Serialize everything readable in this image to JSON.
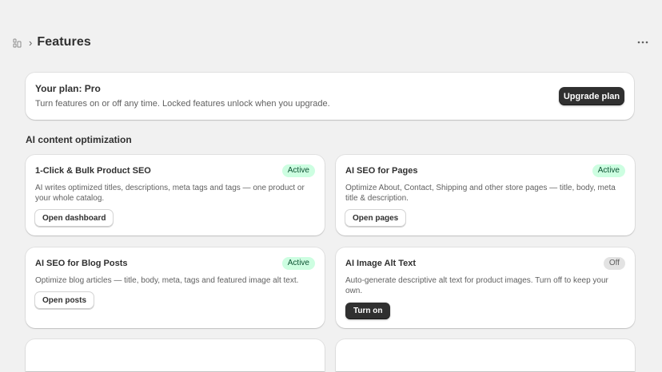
{
  "header": {
    "app_icon": "app-grid-icon",
    "breadcrumb_separator": "›",
    "title": "Features",
    "more_icon": "ellipsis-icon"
  },
  "plan": {
    "title": "Your plan: Pro",
    "description": "Turn features on or off any time. Locked features unlock when you upgrade.",
    "upgrade_label": "Upgrade plan"
  },
  "section": {
    "title": "AI content optimization"
  },
  "features": [
    {
      "title": "1-Click & Bulk Product SEO",
      "status": "Active",
      "description": "AI writes optimized titles, descriptions, meta tags and tags — one product or your whole catalog.",
      "action": "Open dashboard"
    },
    {
      "title": "AI SEO for Pages",
      "status": "Active",
      "description": "Optimize About, Contact, Shipping and other store pages — title, body, meta title & description.",
      "action": "Open pages"
    },
    {
      "title": "AI SEO for Blog Posts",
      "status": "Active",
      "description": "Optimize blog articles — title, body, meta, tags and featured image alt text.",
      "action": "Open posts"
    },
    {
      "title": "AI Image Alt Text",
      "status": "Off",
      "description": "Auto-generate descriptive alt text for product images. Turn off to keep your own.",
      "action": "Turn on"
    }
  ],
  "colors": {
    "background": "#f1f1f1",
    "primary_button": "#303030",
    "active_badge_bg": "#cdfee1",
    "active_badge_text": "#0c5132",
    "off_badge_bg": "#e3e3e3"
  }
}
